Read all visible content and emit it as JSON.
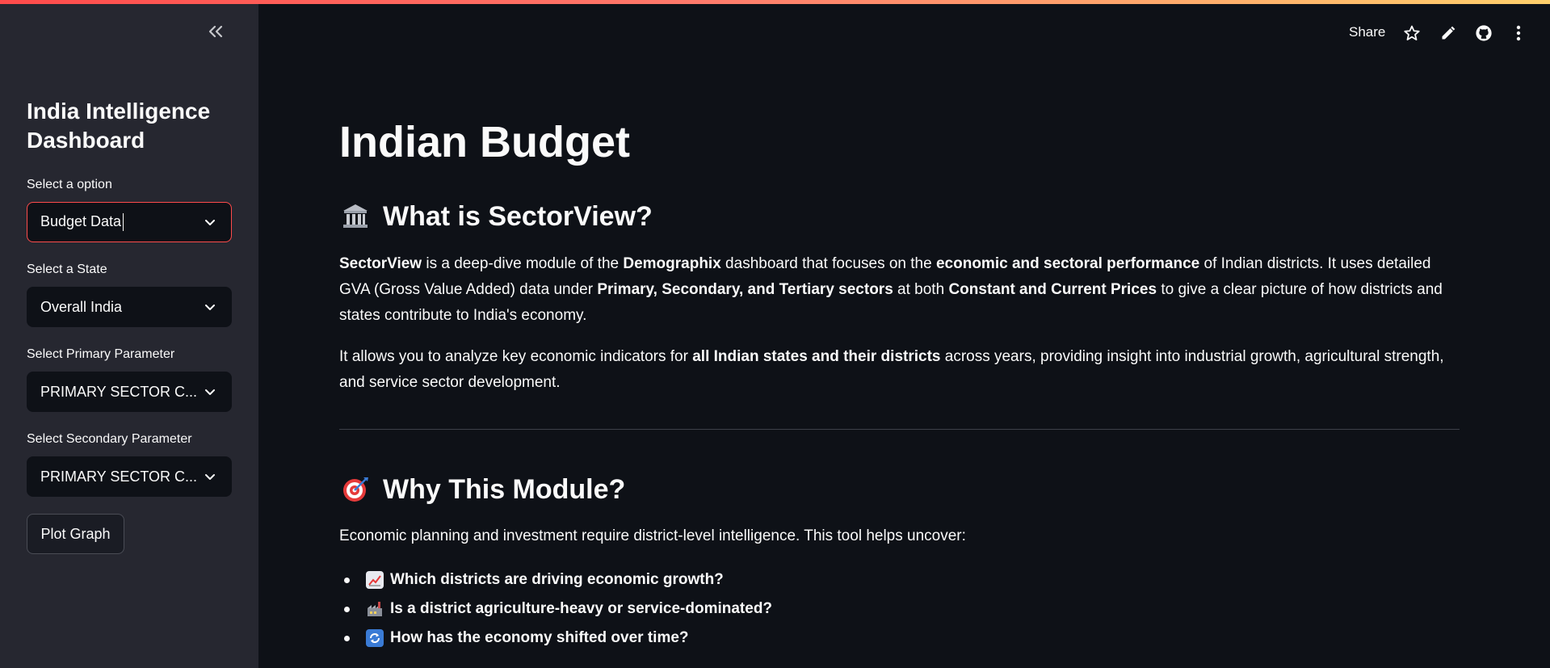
{
  "sidebar": {
    "collapse_icon": "double-chevron-left-icon",
    "title": "India Intelligence Dashboard",
    "option_label": "Select a option",
    "option_value": "Budget Data",
    "state_label": "Select a State",
    "state_value": "Overall India",
    "primary_label": "Select Primary Parameter",
    "primary_value": "PRIMARY SECTOR C...",
    "secondary_label": "Select Secondary Parameter",
    "secondary_value": "PRIMARY SECTOR C...",
    "plot_button": "Plot Graph"
  },
  "toolbar": {
    "share": "Share",
    "icons": [
      "star-icon",
      "pencil-icon",
      "github-icon",
      "more-vertical-icon"
    ]
  },
  "main": {
    "title": "Indian Budget",
    "section1": {
      "heading": "What is SectorView?",
      "icon": "classical-building-icon",
      "p1": {
        "s1": "SectorView",
        "s2": " is a deep-dive module of the ",
        "s3": "Demographix",
        "s4": " dashboard that focuses on the ",
        "s5": "economic and sectoral performance",
        "s6": " of Indian districts. It uses detailed GVA (Gross Value Added) data under ",
        "s7": "Primary, Secondary, and Tertiary sectors",
        "s8": " at both ",
        "s9": "Constant and Current Prices",
        "s10": " to give a clear picture of how districts and states contribute to India's economy."
      },
      "p2": {
        "s1": "It allows you to analyze key economic indicators for ",
        "s2": "all Indian states and their districts",
        "s3": " across years, providing insight into industrial growth, agricultural strength, and service sector development."
      }
    },
    "section2": {
      "heading": "Why This Module?",
      "icon": "direct-hit-target-icon",
      "intro": "Economic planning and investment require district-level intelligence. This tool helps uncover:",
      "bullets": [
        {
          "icon": "chart-increasing-icon",
          "text": "Which districts are driving economic growth?"
        },
        {
          "icon": "factory-icon",
          "text": "Is a district agriculture-heavy or service-dominated?"
        },
        {
          "icon": "arrows-cycle-icon",
          "text": "How has the economy shifted over time?"
        }
      ]
    }
  },
  "colors": {
    "sidebar_bg": "#262730",
    "main_bg": "#0e1117",
    "accent": "#ff4b4b",
    "text": "#fafafa"
  }
}
